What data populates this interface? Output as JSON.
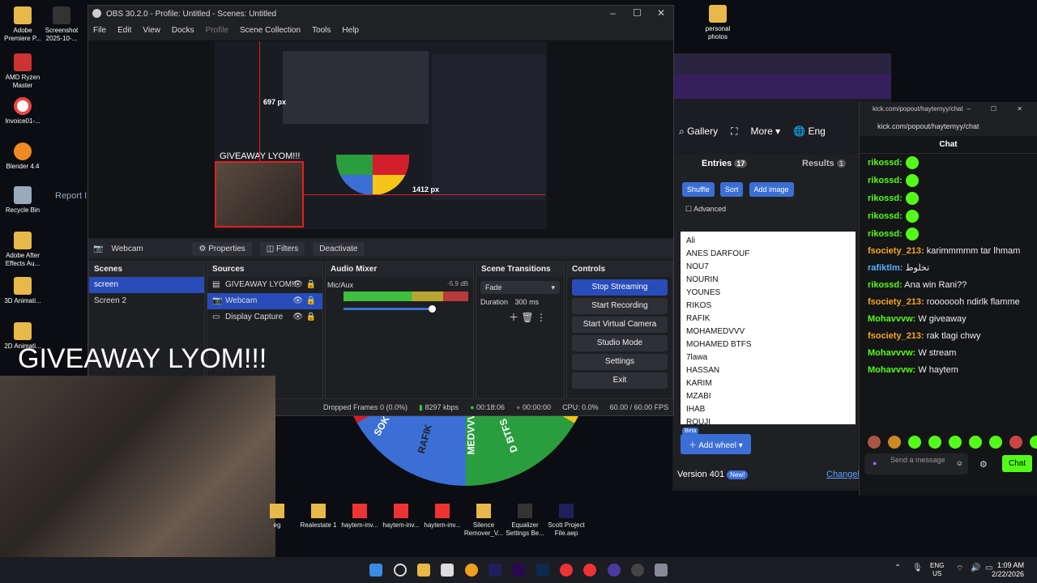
{
  "desktop": {
    "icons": [
      {
        "label": "Adobe Premiere P..."
      },
      {
        "label": "AMD Ryzen Master"
      },
      {
        "label": "Invoice01-..."
      },
      {
        "label": "Blender 4.4"
      },
      {
        "label": "Recycle Bin"
      },
      {
        "label": "Adobe After Effects Au..."
      },
      {
        "label": "3D Animati..."
      },
      {
        "label": "2D Animati..."
      },
      {
        "label": "Screenshot 2025-10-..."
      },
      {
        "label": "personal photos"
      }
    ]
  },
  "obs": {
    "title": "OBS 30.2.0 - Profile: Untitled - Scenes: Untitled",
    "menu": [
      "File",
      "Edit",
      "View",
      "Docks",
      "Profile",
      "Scene Collection",
      "Tools",
      "Help"
    ],
    "preview": {
      "overlay_text": "GIVEAWAY LYOM!!!",
      "dim1": "697 px",
      "dim2": "1412 px"
    },
    "source_bar": {
      "selected": "Webcam",
      "properties": "Properties",
      "filters": "Filters",
      "deactivate": "Deactivate"
    },
    "scenes": {
      "title": "Scenes",
      "items": [
        "screen",
        "Screen 2"
      ]
    },
    "sources": {
      "title": "Sources",
      "items": [
        "GIVEAWAY LYOM!!",
        "Webcam",
        "Display Capture"
      ]
    },
    "audio": {
      "title": "Audio Mixer",
      "channel": "Mic/Aux",
      "level": "-5.9 dB"
    },
    "transitions": {
      "title": "Scene Transitions",
      "type": "Fade",
      "duration_label": "Duration",
      "duration": "300 ms"
    },
    "controls": {
      "title": "Controls",
      "buttons": [
        "Stop Streaming",
        "Start Recording",
        "Start Virtual Camera",
        "Studio Mode",
        "Settings",
        "Exit"
      ]
    },
    "status": {
      "dropped": "Dropped Frames 0 (0.0%)",
      "kbps": "8297 kbps",
      "live_time": "00:18:06",
      "rec_time": "00:00:00",
      "cpu": "CPU: 0.0%",
      "fps": "60.00 / 60.00 FPS"
    }
  },
  "overlay": {
    "giveaway": "GIVEAWAY LYOM!!!"
  },
  "wheel_app": {
    "gallery": "Gallery",
    "more": "More",
    "lang": "Eng",
    "entries_tab": "Entries",
    "entries_count": "17",
    "results_tab": "Results",
    "results_count": "1",
    "shuffle": "Shuffle",
    "sort": "Sort",
    "add_image": "Add image",
    "advanced": "Advanced",
    "entries": [
      "Ali",
      "ANES DARFOUF",
      "NOU7",
      "NOURIN",
      "YOUNES",
      "RIKOS",
      "RAFIK",
      "MOHAMEDVVV",
      "MOHAMED BTFS",
      "7lawa",
      "HASSAN",
      "KARIM",
      "MZABI",
      "IHAB",
      "ROUJI"
    ],
    "beta": "Beta",
    "add_wheel": "Add wheel",
    "version": "Version 401",
    "new_badge": "New!",
    "changelog": "Changel",
    "wheel_labels": [
      "SOK",
      "RAFIK",
      "MEDVVV",
      "D BTFS"
    ],
    "report": "Report I"
  },
  "chat": {
    "window_url": "kick.com/popout/haytemyy/chat",
    "address": "kick.com/popout/haytemyy/chat",
    "header": "Chat",
    "messages": [
      {
        "user": "rikossd:",
        "text": "",
        "color": "#53fc18"
      },
      {
        "user": "rikossd:",
        "text": "",
        "color": "#53fc18"
      },
      {
        "user": "rikossd:",
        "text": "",
        "color": "#53fc18"
      },
      {
        "user": "rikossd:",
        "text": "",
        "color": "#53fc18"
      },
      {
        "user": "rikossd:",
        "text": "",
        "color": "#53fc18"
      },
      {
        "user": "fsociety_213:",
        "text": "karimmmmm tar lhmam",
        "color": "#f5a623"
      },
      {
        "user": "rafiktlm:",
        "text": "تخلوط",
        "color": "#5ab0ff"
      },
      {
        "user": "rikossd:",
        "text": "Ana win Rani??",
        "color": "#53fc18"
      },
      {
        "user": "fsociety_213:",
        "text": "rooooooh ndirlk flamme",
        "color": "#f5a623"
      },
      {
        "user": "Mohavvvw:",
        "text": "W giveaway",
        "color": "#53fc18"
      },
      {
        "user": "fsociety_213:",
        "text": "rak tlagi chwy",
        "color": "#f5a623"
      },
      {
        "user": "Mohavvvw:",
        "text": "W stream",
        "color": "#53fc18"
      },
      {
        "user": "Mohavvvw:",
        "text": "W haytem",
        "color": "#53fc18"
      }
    ],
    "input_placeholder": "Send a message",
    "send": "Chat"
  },
  "files": [
    {
      "label": "eg"
    },
    {
      "label": "Realestate 1"
    },
    {
      "label": "haytem-inv..."
    },
    {
      "label": "haytem-inv..."
    },
    {
      "label": "haytem-inv..."
    },
    {
      "label": "Silence Remover_V..."
    },
    {
      "label": "Equalizer Settings Be..."
    },
    {
      "label": "Scott Project File.aep"
    }
  ],
  "taskbar": {
    "lang1": "ENG",
    "lang2": "US",
    "time": "1:09 AM",
    "date": "2/22/2026"
  }
}
